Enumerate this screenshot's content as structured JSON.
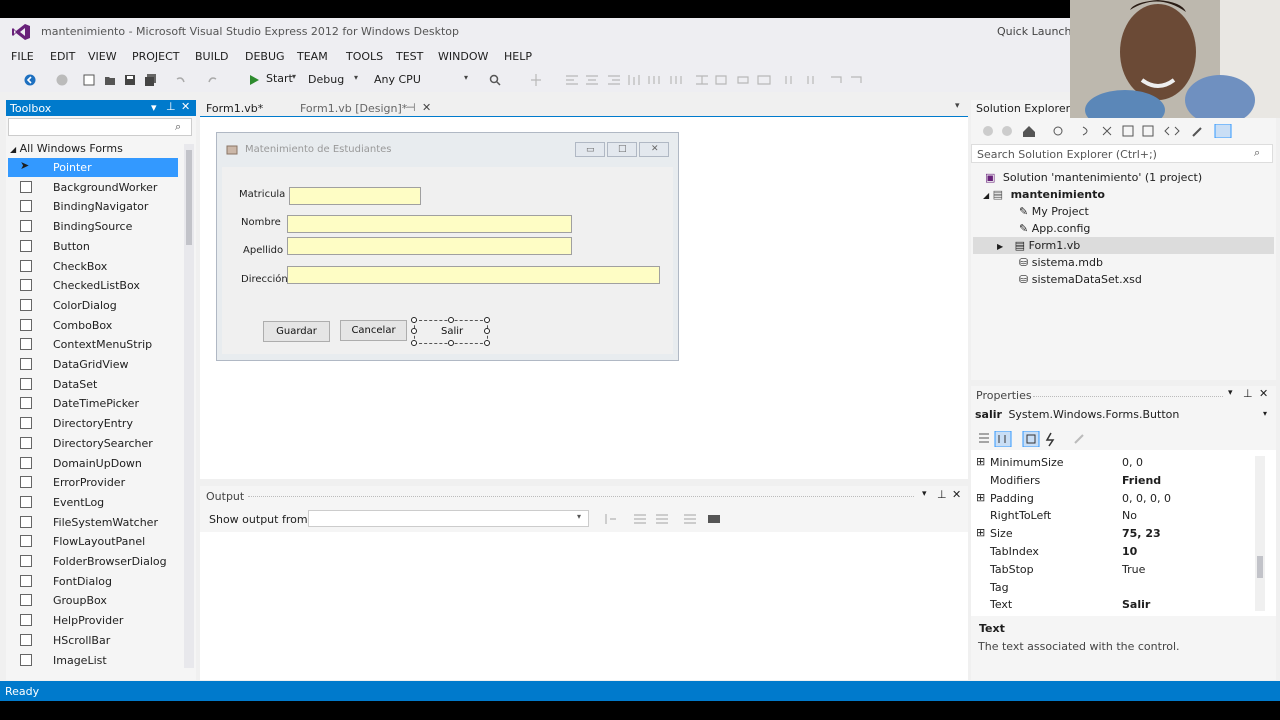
{
  "window": {
    "title": "mantenimiento - Microsoft Visual Studio Express 2012 for Windows Desktop",
    "quick_launch": "Quick Launch"
  },
  "menu": [
    "FILE",
    "EDIT",
    "VIEW",
    "PROJECT",
    "BUILD",
    "DEBUG",
    "TEAM",
    "TOOLS",
    "TEST",
    "WINDOW",
    "HELP"
  ],
  "toolbar": {
    "start": "Start",
    "config": "Debug",
    "platform": "Any CPU"
  },
  "toolbox": {
    "title": "Toolbox",
    "group": "All Windows Forms",
    "items": [
      "Pointer",
      "BackgroundWorker",
      "BindingNavigator",
      "BindingSource",
      "Button",
      "CheckBox",
      "CheckedListBox",
      "ColorDialog",
      "ComboBox",
      "ContextMenuStrip",
      "DataGridView",
      "DataSet",
      "DateTimePicker",
      "DirectoryEntry",
      "DirectorySearcher",
      "DomainUpDown",
      "ErrorProvider",
      "EventLog",
      "FileSystemWatcher",
      "FlowLayoutPanel",
      "FolderBrowserDialog",
      "FontDialog",
      "GroupBox",
      "HelpProvider",
      "HScrollBar",
      "ImageList"
    ]
  },
  "tabs": [
    "Form1.vb*",
    "Form1.vb [Design]*"
  ],
  "form": {
    "title": "Matenimiento de Estudiantes",
    "labels": [
      "Matricula",
      "Nombre",
      "Apellido",
      "Dirección"
    ],
    "buttons": [
      "Guardar",
      "Cancelar",
      "Salir"
    ]
  },
  "output": {
    "title": "Output",
    "show_from": "Show output from:"
  },
  "solution_explorer": {
    "title": "Solution Explorer",
    "search": "Search Solution Explorer (Ctrl+;)",
    "items": [
      "Solution 'mantenimiento' (1 project)",
      "mantenimiento",
      "My Project",
      "App.config",
      "Form1.vb",
      "sistema.mdb",
      "sistemaDataSet.xsd"
    ]
  },
  "properties": {
    "title": "Properties",
    "object_name": "salir",
    "object_type": "System.Windows.Forms.Button",
    "rows": [
      {
        "name": "MinimumSize",
        "value": "0, 0",
        "expand": true,
        "bold": false
      },
      {
        "name": "Modifiers",
        "value": "Friend",
        "expand": false,
        "bold": true
      },
      {
        "name": "Padding",
        "value": "0, 0, 0, 0",
        "expand": true,
        "bold": false
      },
      {
        "name": "RightToLeft",
        "value": "No",
        "expand": false,
        "bold": false
      },
      {
        "name": "Size",
        "value": "75, 23",
        "expand": true,
        "bold": true
      },
      {
        "name": "TabIndex",
        "value": "10",
        "expand": false,
        "bold": true
      },
      {
        "name": "TabStop",
        "value": "True",
        "expand": false,
        "bold": false
      },
      {
        "name": "Tag",
        "value": "",
        "expand": false,
        "bold": false
      },
      {
        "name": "Text",
        "value": "Salir",
        "expand": false,
        "bold": true
      }
    ],
    "desc_title": "Text",
    "desc_text": "The text associated with the control."
  },
  "status": "Ready",
  "colors": {
    "accent": "#007acc",
    "selection": "#3399ff",
    "textbox": "#fefdc5"
  }
}
